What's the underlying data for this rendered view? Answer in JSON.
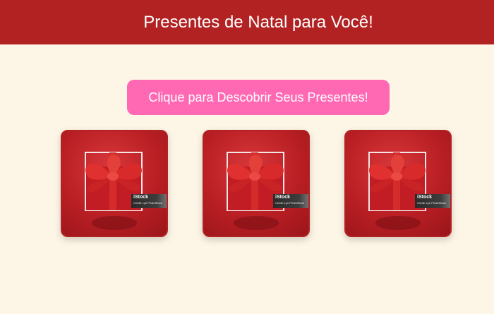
{
  "header": {
    "title": "Presentes de Natal para Você!"
  },
  "cta": {
    "label": "Clique para Descobrir Seus Presentes!"
  },
  "gifts": [
    {
      "watermark_brand": "iStock",
      "watermark_credit": "Credit: Lyn PhotoStock"
    },
    {
      "watermark_brand": "iStock",
      "watermark_credit": "Credit: Lyn PhotoStock"
    },
    {
      "watermark_brand": "iStock",
      "watermark_credit": "Credit: Lyn PhotoStock"
    }
  ],
  "colors": {
    "header_bg": "#b22222",
    "page_bg": "#fdf5e6",
    "button_bg": "#ff69b4",
    "gift_red": "#b91f24"
  }
}
